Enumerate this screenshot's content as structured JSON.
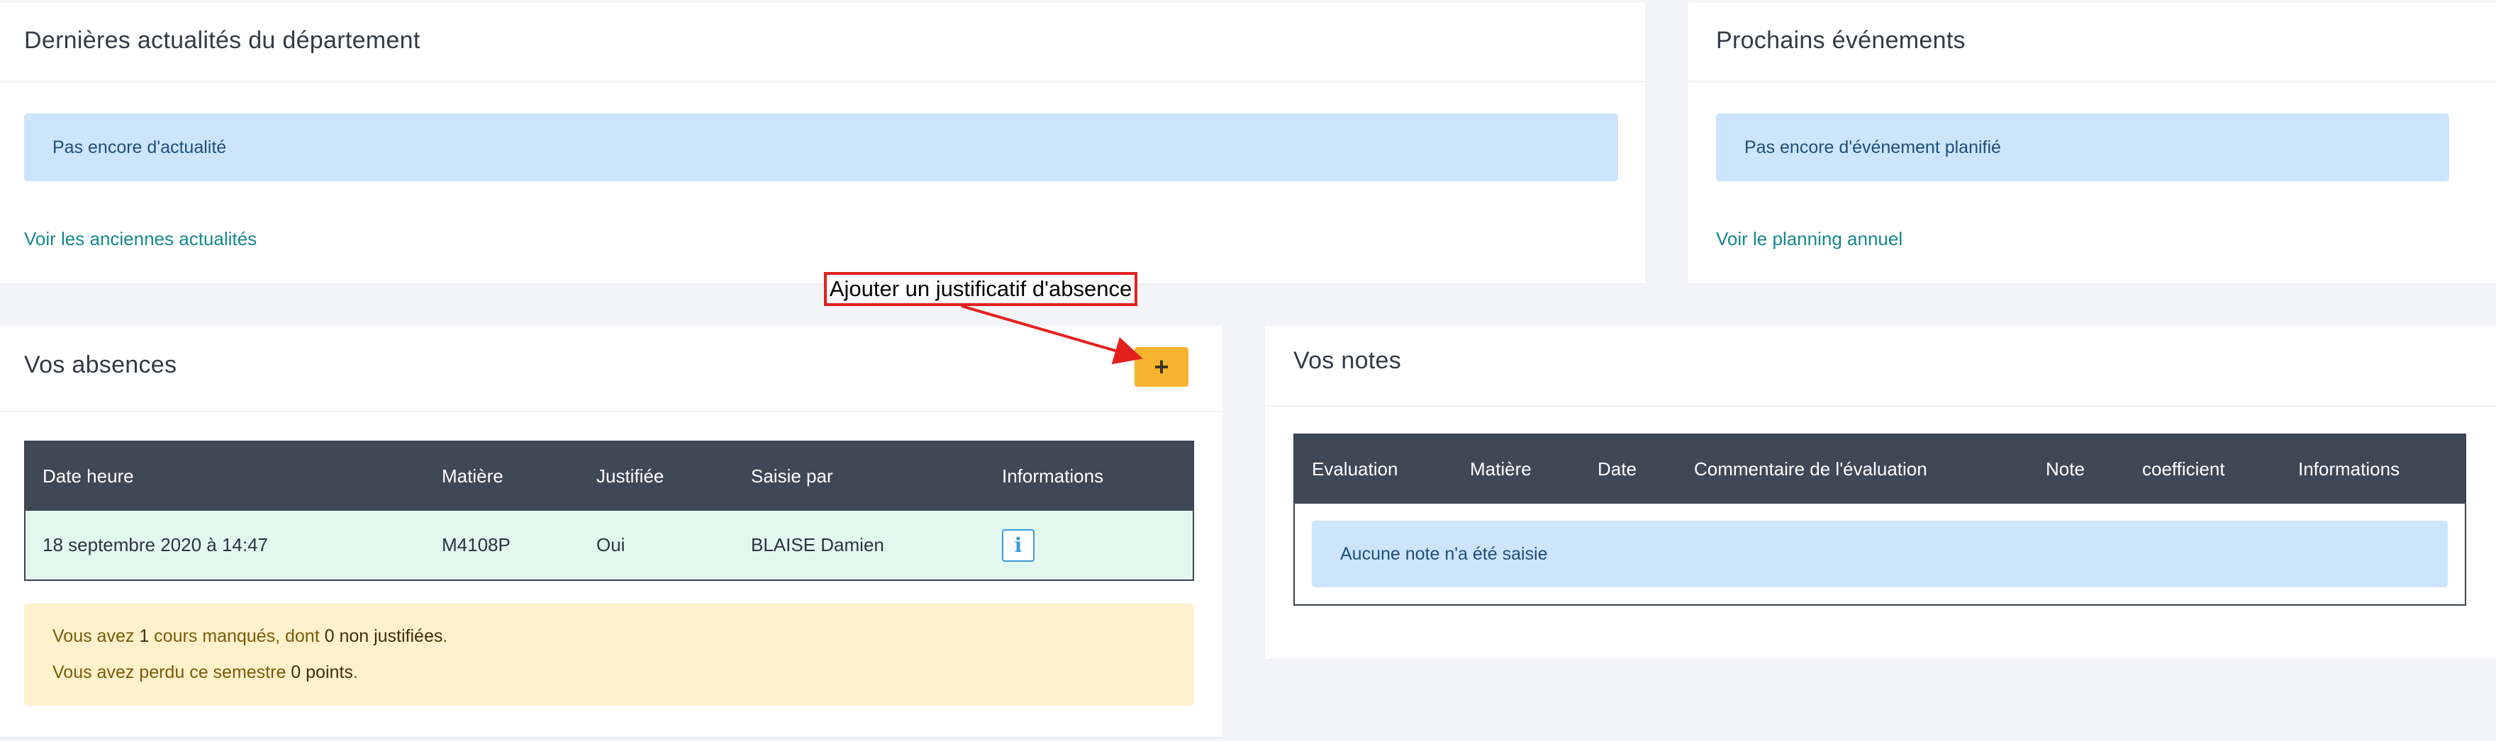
{
  "news": {
    "title": "Dernières actualités du département",
    "empty_message": "Pas encore d'actualité",
    "link": "Voir les anciennes actualités"
  },
  "events": {
    "title": "Prochains événements",
    "empty_message": "Pas encore d'événement planifié",
    "link": "Voir le planning annuel"
  },
  "annotation": {
    "label": "Ajouter un justificatif d'absence",
    "color": "#e3211f"
  },
  "absences": {
    "title": "Vos absences",
    "add_button": "+",
    "columns": [
      "Date heure",
      "Matière",
      "Justifiée",
      "Saisie par",
      "Informations"
    ],
    "rows": [
      {
        "date": "18 septembre 2020 à 14:47",
        "subject": "M4108P",
        "justified": "Oui",
        "entered_by": "BLAISE Damien",
        "info_icon": "i"
      }
    ],
    "summary": {
      "line1_prefix": "Vous avez ",
      "missed_count": "1",
      "line1_mid": " cours manqués, dont ",
      "unjustified": "0 non justifiées",
      "line1_end": ".",
      "line2_prefix": "Vous avez perdu ce semestre ",
      "points": "0 points",
      "line2_end": "."
    }
  },
  "grades": {
    "title": "Vos notes",
    "columns": [
      "Evaluation",
      "Matière",
      "Date",
      "Commentaire de l'évaluation",
      "Note",
      "coefficient",
      "Informations"
    ],
    "empty_message": "Aucune note n'a été saisie"
  },
  "colors": {
    "table_header": "#3f4855",
    "info_alert": "#cce5fc",
    "warning_alert": "#fff1cc",
    "add_button": "#f6b32d",
    "link": "#15878f",
    "row_highlight": "#e2f8ef"
  }
}
